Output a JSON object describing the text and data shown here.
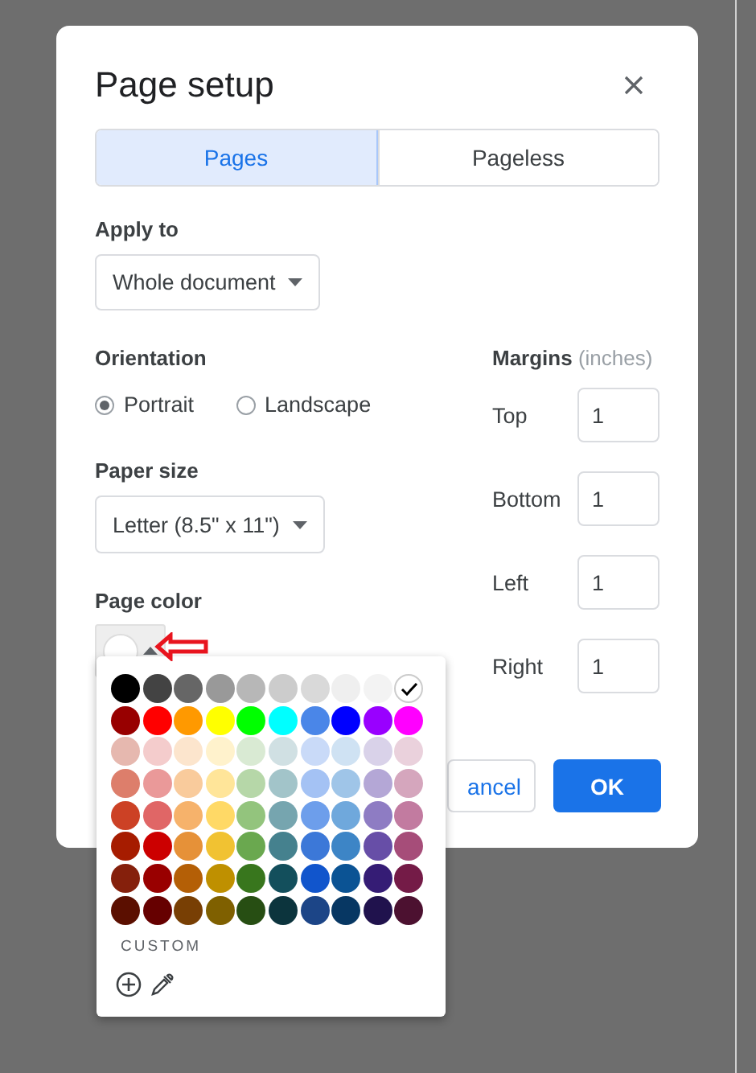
{
  "dialog": {
    "title": "Page setup"
  },
  "tabs": [
    {
      "label": "Pages",
      "selected": true
    },
    {
      "label": "Pageless",
      "selected": false
    }
  ],
  "apply_to": {
    "label": "Apply to",
    "value": "Whole document"
  },
  "orientation": {
    "label": "Orientation",
    "options": [
      {
        "label": "Portrait",
        "selected": true
      },
      {
        "label": "Landscape",
        "selected": false
      }
    ]
  },
  "paper_size": {
    "label": "Paper size",
    "value": "Letter (8.5\" x 11\")"
  },
  "page_color": {
    "label": "Page color"
  },
  "margins": {
    "label": "Margins",
    "unit": "(inches)",
    "fields": [
      {
        "label": "Top",
        "value": "1"
      },
      {
        "label": "Bottom",
        "value": "1"
      },
      {
        "label": "Left",
        "value": "1"
      },
      {
        "label": "Right",
        "value": "1"
      }
    ]
  },
  "buttons": [
    {
      "label": "ancel",
      "kind": "secondary"
    },
    {
      "label": "OK",
      "kind": "primary"
    }
  ],
  "color_menu": {
    "custom_label": "CUSTOM",
    "rows": [
      [
        {
          "color": "#000000",
          "selected": false
        },
        {
          "color": "#434343",
          "selected": false
        },
        {
          "color": "#666666",
          "selected": false
        },
        {
          "color": "#999999",
          "selected": false
        },
        {
          "color": "#b7b7b7",
          "selected": false
        },
        {
          "color": "#cccccc",
          "selected": false
        },
        {
          "color": "#d9d9d9",
          "selected": false
        },
        {
          "color": "#efefef",
          "selected": false
        },
        {
          "color": "#f3f3f3",
          "selected": false
        },
        {
          "color": "#ffffff",
          "selected": true
        }
      ],
      [
        {
          "color": "#980000",
          "selected": false
        },
        {
          "color": "#ff0000",
          "selected": false
        },
        {
          "color": "#ff9900",
          "selected": false
        },
        {
          "color": "#ffff00",
          "selected": false
        },
        {
          "color": "#00ff00",
          "selected": false
        },
        {
          "color": "#00ffff",
          "selected": false
        },
        {
          "color": "#4a86e8",
          "selected": false
        },
        {
          "color": "#0000ff",
          "selected": false
        },
        {
          "color": "#9900ff",
          "selected": false
        },
        {
          "color": "#ff00ff",
          "selected": false
        }
      ],
      [
        {
          "color": "#e6b8af",
          "selected": false
        },
        {
          "color": "#f4cccc",
          "selected": false
        },
        {
          "color": "#fce5cd",
          "selected": false
        },
        {
          "color": "#fff2cc",
          "selected": false
        },
        {
          "color": "#d9ead3",
          "selected": false
        },
        {
          "color": "#d0e0e3",
          "selected": false
        },
        {
          "color": "#c9daf8",
          "selected": false
        },
        {
          "color": "#cfe2f3",
          "selected": false
        },
        {
          "color": "#d9d2e9",
          "selected": false
        },
        {
          "color": "#ead1dc",
          "selected": false
        }
      ],
      [
        {
          "color": "#dd7e6b",
          "selected": false
        },
        {
          "color": "#ea9999",
          "selected": false
        },
        {
          "color": "#f9cb9c",
          "selected": false
        },
        {
          "color": "#ffe599",
          "selected": false
        },
        {
          "color": "#b6d7a8",
          "selected": false
        },
        {
          "color": "#a2c4c9",
          "selected": false
        },
        {
          "color": "#a4c2f4",
          "selected": false
        },
        {
          "color": "#9fc5e8",
          "selected": false
        },
        {
          "color": "#b4a7d6",
          "selected": false
        },
        {
          "color": "#d5a6bd",
          "selected": false
        }
      ],
      [
        {
          "color": "#cc4125",
          "selected": false
        },
        {
          "color": "#e06666",
          "selected": false
        },
        {
          "color": "#f6b26b",
          "selected": false
        },
        {
          "color": "#ffd966",
          "selected": false
        },
        {
          "color": "#93c47d",
          "selected": false
        },
        {
          "color": "#76a5af",
          "selected": false
        },
        {
          "color": "#6d9eeb",
          "selected": false
        },
        {
          "color": "#6fa8dc",
          "selected": false
        },
        {
          "color": "#8e7cc3",
          "selected": false
        },
        {
          "color": "#c27ba0",
          "selected": false
        }
      ],
      [
        {
          "color": "#a61c00",
          "selected": false
        },
        {
          "color": "#cc0000",
          "selected": false
        },
        {
          "color": "#e69138",
          "selected": false
        },
        {
          "color": "#f1c232",
          "selected": false
        },
        {
          "color": "#6aa84f",
          "selected": false
        },
        {
          "color": "#45818e",
          "selected": false
        },
        {
          "color": "#3c78d8",
          "selected": false
        },
        {
          "color": "#3d85c6",
          "selected": false
        },
        {
          "color": "#674ea7",
          "selected": false
        },
        {
          "color": "#a64d79",
          "selected": false
        }
      ],
      [
        {
          "color": "#85200c",
          "selected": false
        },
        {
          "color": "#990000",
          "selected": false
        },
        {
          "color": "#b45f06",
          "selected": false
        },
        {
          "color": "#bf9000",
          "selected": false
        },
        {
          "color": "#38761d",
          "selected": false
        },
        {
          "color": "#134f5c",
          "selected": false
        },
        {
          "color": "#1155cc",
          "selected": false
        },
        {
          "color": "#0b5394",
          "selected": false
        },
        {
          "color": "#351c75",
          "selected": false
        },
        {
          "color": "#741b47",
          "selected": false
        }
      ],
      [
        {
          "color": "#5b0f00",
          "selected": false
        },
        {
          "color": "#660000",
          "selected": false
        },
        {
          "color": "#783f04",
          "selected": false
        },
        {
          "color": "#7f6000",
          "selected": false
        },
        {
          "color": "#274e13",
          "selected": false
        },
        {
          "color": "#0c343d",
          "selected": false
        },
        {
          "color": "#1c4587",
          "selected": false
        },
        {
          "color": "#073763",
          "selected": false
        },
        {
          "color": "#20124d",
          "selected": false
        },
        {
          "color": "#4c1130",
          "selected": false
        }
      ]
    ]
  }
}
